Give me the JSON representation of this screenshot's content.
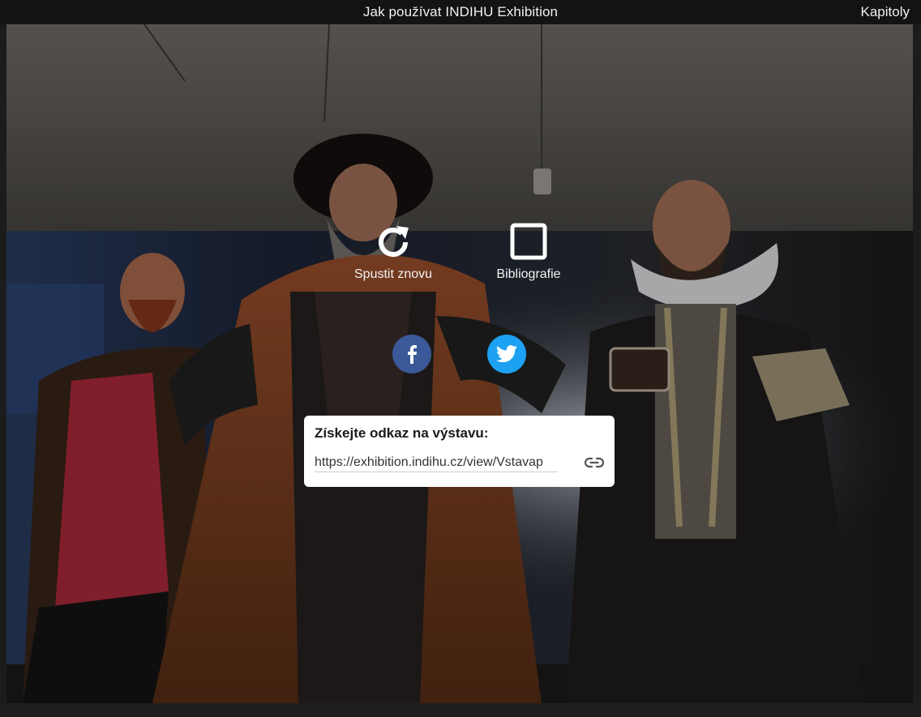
{
  "topbar": {
    "title": "Jak používat INDIHU Exhibition",
    "chapters_label": "Kapitoly"
  },
  "actions": {
    "restart_label": "Spustit znovu",
    "restart_icon": "refresh-icon",
    "bibliography_label": "Bibliografie",
    "bibliography_icon": "square-icon"
  },
  "share": {
    "facebook_icon": "facebook-icon",
    "twitter_icon": "twitter-icon",
    "facebook_color": "#3b5998",
    "twitter_color": "#1da1f2"
  },
  "link_card": {
    "title": "Získejte odkaz na výstavu:",
    "url": "https://exhibition.indihu.cz/view/Vstavap",
    "copy_icon": "link-icon"
  }
}
